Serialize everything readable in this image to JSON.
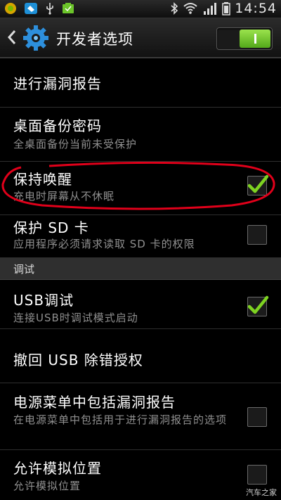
{
  "status_bar": {
    "time": "14:54"
  },
  "action_bar": {
    "title": "开发者选项",
    "master_switch_on": true
  },
  "items": [
    {
      "title": "进行漏洞报告"
    },
    {
      "title": "桌面备份密码",
      "summary": "全桌面备份当前未受保护"
    },
    {
      "title": "保持唤醒",
      "summary": "充电时屏幕从不休眠",
      "checked": true
    },
    {
      "title": "保护 SD 卡",
      "summary": "应用程序必须请求读取 SD 卡的权限",
      "checked": false
    }
  ],
  "section": {
    "label": "调试"
  },
  "debug_items": [
    {
      "title": "USB调试",
      "summary": "连接USB时调试模式启动",
      "checked": true
    },
    {
      "title": "撤回 USB 除错授权"
    },
    {
      "title": "电源菜单中包括漏洞报告",
      "summary": "在电源菜单中包括用于进行漏洞报告的选项",
      "checked": false
    },
    {
      "title": "允许模拟位置",
      "summary": "允许模拟位置",
      "checked": false
    }
  ],
  "watermark": "汽车之家",
  "colors": {
    "check_green": "#7ed321",
    "highlight_circle": "#e0001a",
    "switch_green": "#6cc52a"
  }
}
